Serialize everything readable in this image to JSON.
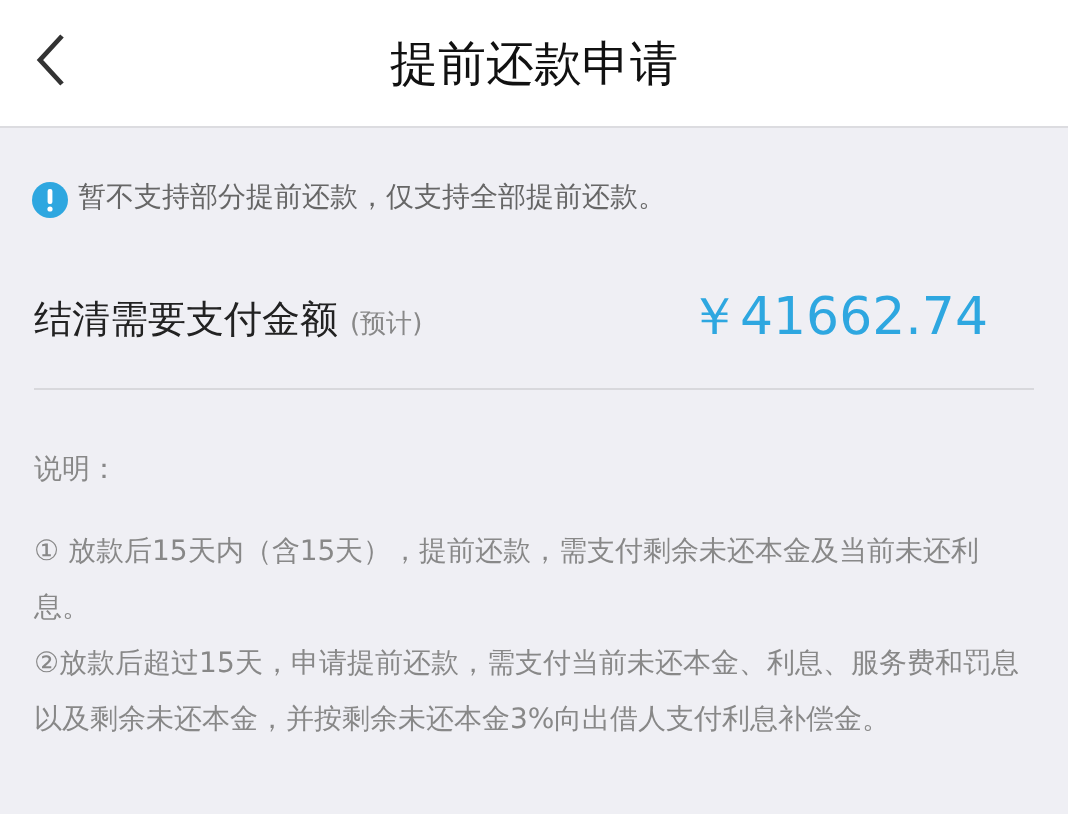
{
  "header": {
    "title": "提前还款申请"
  },
  "notice": {
    "text": "暂不支持部分提前还款，仅支持全部提前还款。"
  },
  "amount": {
    "label": "结清需要支付金额",
    "note": "(预计)",
    "value": "￥41662.74"
  },
  "explanation": {
    "heading": "说明：",
    "items": [
      "① 放款后15天内（含15天），提前还款，需支付剩余未还本金及当前未还利息。",
      "②放款后超过15天，申请提前还款，需支付当前未还本金、利息、服务费和罚息以及剩余未还本金，并按剩余未还本金3%向出借人支付利息补偿金。"
    ]
  }
}
